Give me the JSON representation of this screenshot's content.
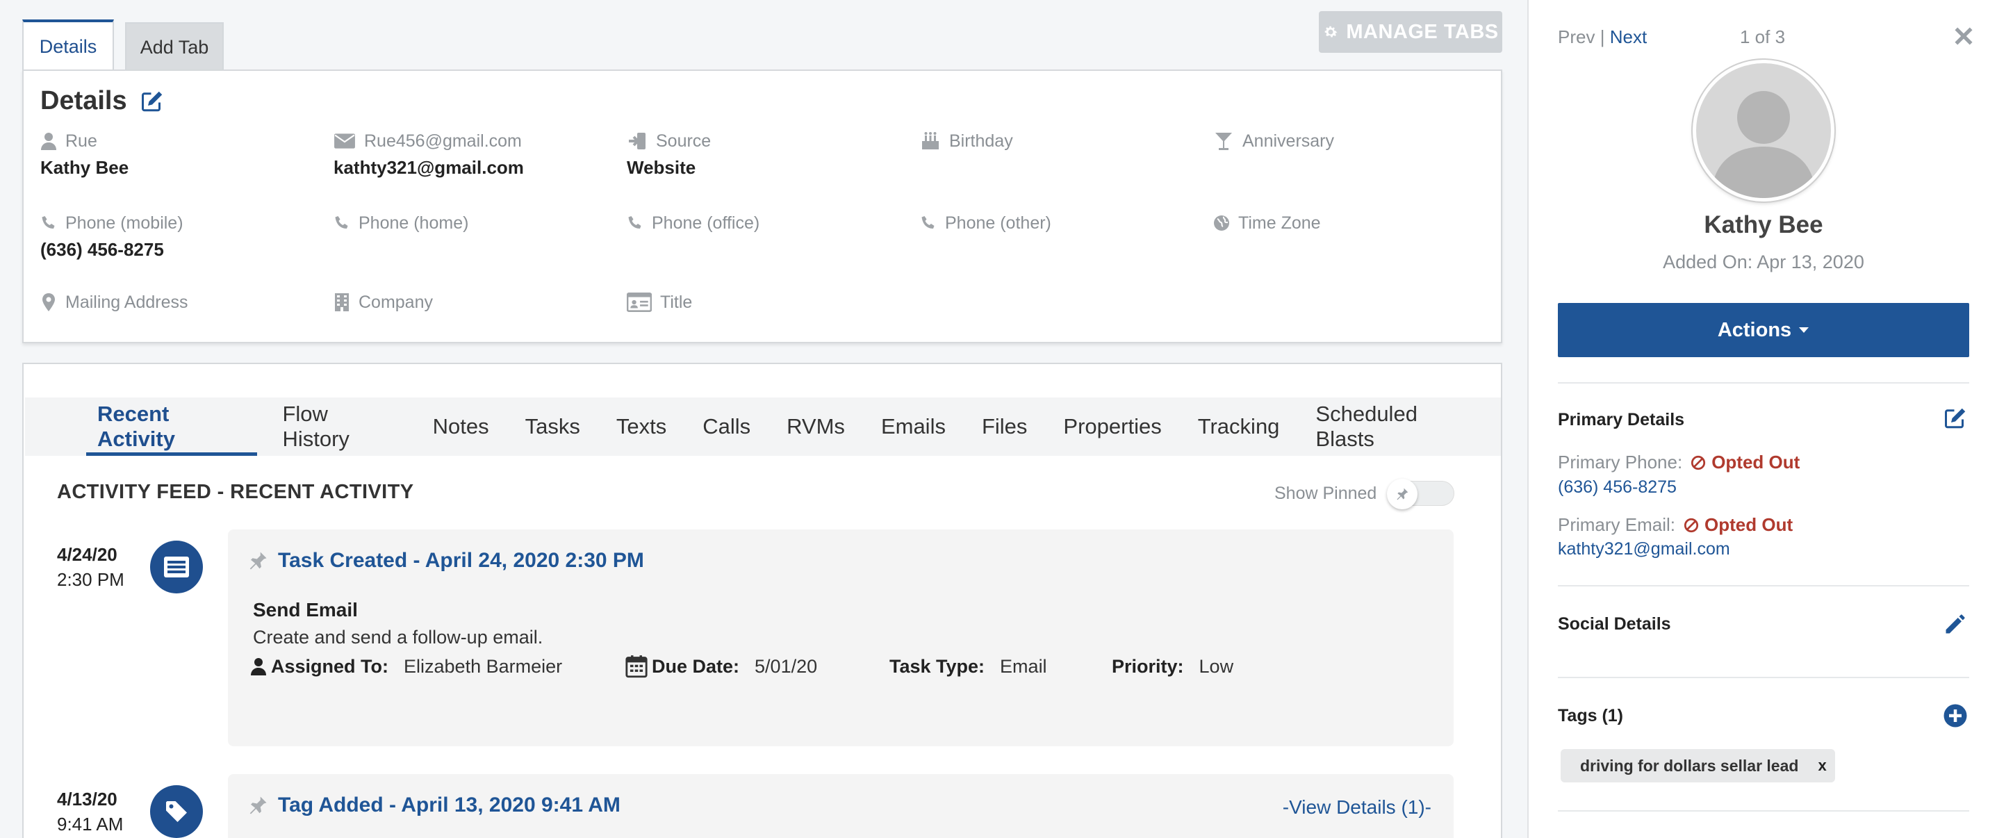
{
  "tabs": [
    {
      "label": "Details"
    },
    {
      "label": "Add Tab"
    }
  ],
  "manage_tabs_label": "MANAGE TABS",
  "details": {
    "title": "Details",
    "fields": {
      "name": {
        "label": "Rue",
        "value": "Kathy Bee"
      },
      "email": {
        "label": "Rue456@gmail.com",
        "value": "kathty321@gmail.com"
      },
      "source": {
        "label": "Source",
        "value": "Website"
      },
      "birthday": {
        "label": "Birthday",
        "value": ""
      },
      "anniversary": {
        "label": "Anniversary",
        "value": ""
      },
      "phone_mobile": {
        "label": "Phone  (mobile)",
        "value": "(636) 456-8275"
      },
      "phone_home": {
        "label": "Phone  (home)",
        "value": ""
      },
      "phone_office": {
        "label": "Phone  (office)",
        "value": ""
      },
      "phone_other": {
        "label": "Phone  (other)",
        "value": ""
      },
      "time_zone": {
        "label": "Time Zone",
        "value": ""
      },
      "mailing_address": {
        "label": "Mailing Address",
        "value": ""
      },
      "company": {
        "label": "Company",
        "value": ""
      },
      "title": {
        "label": "Title",
        "value": ""
      }
    }
  },
  "subnav": [
    "Recent Activity",
    "Flow History",
    "Notes",
    "Tasks",
    "Texts",
    "Calls",
    "RVMs",
    "Emails",
    "Files",
    "Properties",
    "Tracking",
    "Scheduled Blasts"
  ],
  "feed": {
    "title": "ACTIVITY FEED - RECENT ACTIVITY",
    "show_pinned_label": "Show Pinned",
    "entries": [
      {
        "date": "4/24/20",
        "time": "2:30 PM",
        "heading": "Task Created - April 24, 2020 2:30 PM",
        "subject": "Send Email",
        "description": "Create and send a follow-up email.",
        "assigned_label": "Assigned To:",
        "assigned_value": "Elizabeth Barmeier",
        "due_label": "Due Date:",
        "due_value": "5/01/20",
        "type_label": "Task Type:",
        "type_value": "Email",
        "priority_label": "Priority:",
        "priority_value": "Low"
      },
      {
        "date": "4/13/20",
        "time": "9:41 AM",
        "heading": "Tag Added - April 13, 2020 9:41 AM",
        "view_details": "-View Details (1)-"
      }
    ]
  },
  "side": {
    "prev_label": "Prev",
    "separator": "|",
    "next_label": "Next",
    "position": "1 of 3",
    "name": "Kathy Bee",
    "added_on": "Added On: Apr 13, 2020",
    "actions_label": "Actions",
    "primary_details": {
      "title": "Primary Details",
      "phone_label": "Primary Phone:",
      "phone_status": "Opted Out",
      "phone_value": "(636) 456-8275",
      "email_label": "Primary Email:",
      "email_status": "Opted Out",
      "email_value": "kathty321@gmail.com"
    },
    "social_title": "Social Details",
    "tags_title": "Tags (1)",
    "tags": [
      "driving for dollars sellar lead"
    ],
    "tag_remove": "x"
  },
  "colors": {
    "primary": "#1f5596",
    "opted_out": "#b03a2e",
    "muted": "#8a8f94"
  }
}
